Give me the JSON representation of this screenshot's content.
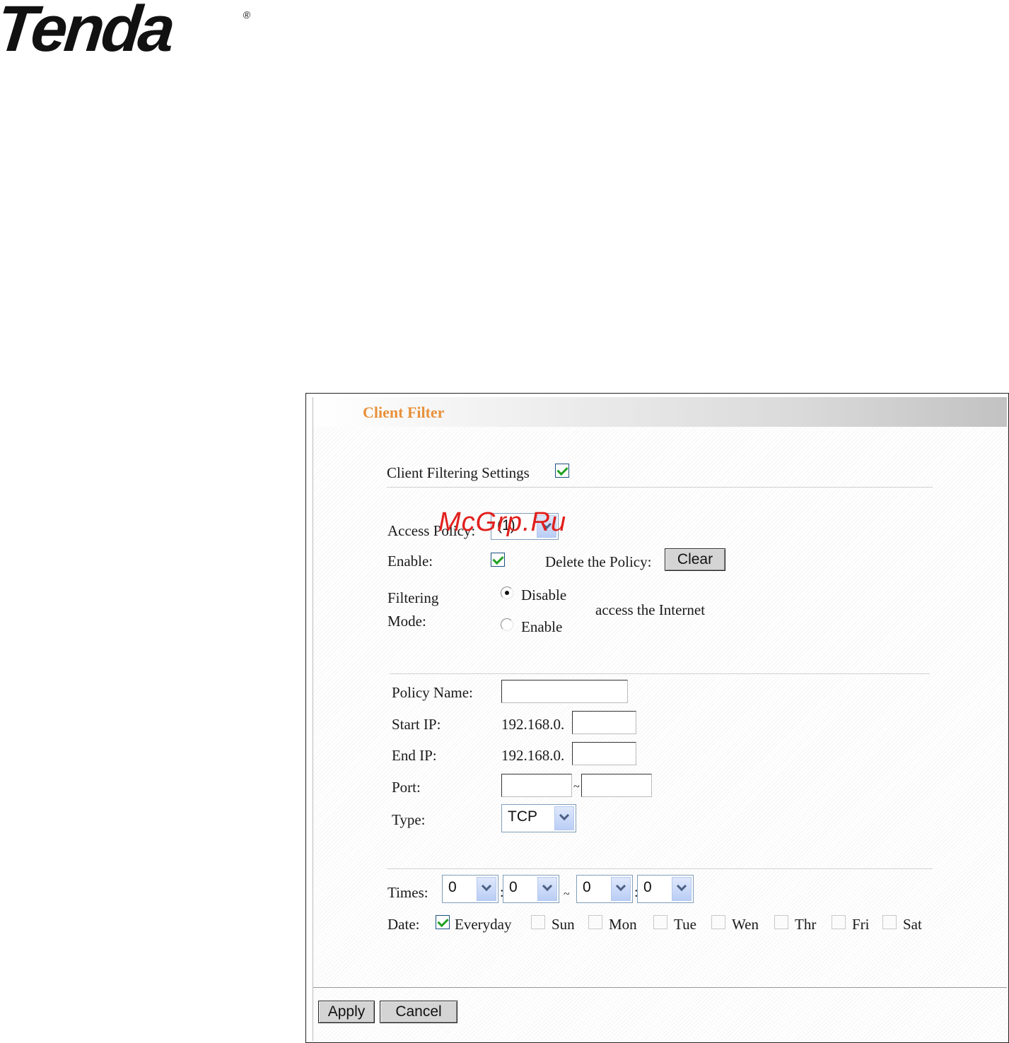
{
  "brand": {
    "logo_text": "Tenda",
    "registered_mark": "®"
  },
  "panel": {
    "title": "Client Filter",
    "client_filtering_settings": {
      "label": "Client Filtering Settings",
      "checked": true
    },
    "access_policy": {
      "label": "Access Policy:",
      "value": "(1)"
    },
    "enable": {
      "label": "Enable:",
      "checked": true
    },
    "delete_policy": {
      "label": "Delete the Policy:",
      "button": "Clear"
    },
    "filtering_mode": {
      "label_line1": "Filtering",
      "label_line2": "Mode:",
      "options": [
        "Disable",
        "Enable"
      ],
      "selected": "Disable",
      "suffix": "access the Internet"
    },
    "policy_name": {
      "label": "Policy Name:",
      "value": ""
    },
    "start_ip": {
      "label": "Start IP:",
      "prefix": "192.168.0.",
      "value": ""
    },
    "end_ip": {
      "label": "End IP:",
      "prefix": "192.168.0.",
      "value": ""
    },
    "port": {
      "label": "Port:",
      "from": "",
      "to": "",
      "separator": "~"
    },
    "type": {
      "label": "Type:",
      "value": "TCP"
    },
    "times": {
      "label": "Times:",
      "start_hour": "0",
      "start_minute": "0",
      "end_hour": "0",
      "end_minute": "0",
      "colon": ":",
      "range_separator": "~"
    },
    "date": {
      "label": "Date:",
      "days": [
        {
          "label": "Everyday",
          "checked": true
        },
        {
          "label": "Sun",
          "checked": false
        },
        {
          "label": "Mon",
          "checked": false
        },
        {
          "label": "Tue",
          "checked": false
        },
        {
          "label": "Wen",
          "checked": false
        },
        {
          "label": "Thr",
          "checked": false
        },
        {
          "label": "Fri",
          "checked": false
        },
        {
          "label": "Sat",
          "checked": false
        }
      ]
    },
    "buttons": {
      "apply": "Apply",
      "cancel": "Cancel"
    }
  },
  "watermark": "McGrp.Ru"
}
